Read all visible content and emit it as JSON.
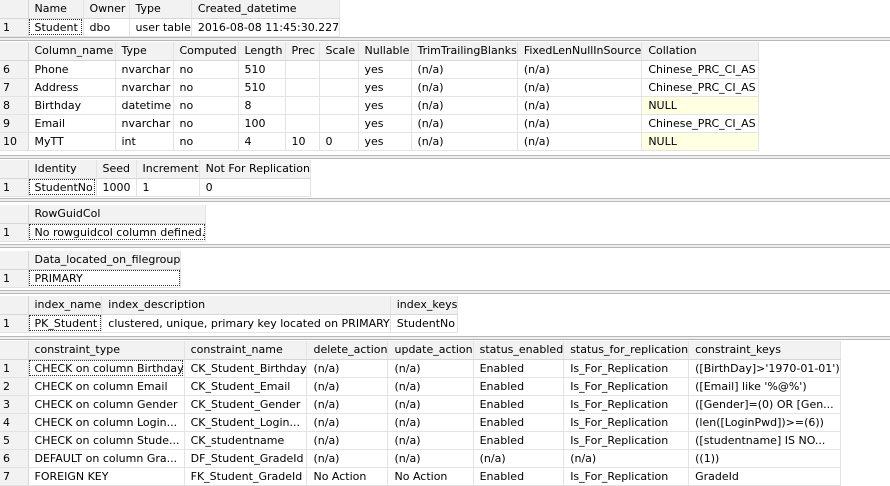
{
  "table_info": {
    "headers": [
      "Name",
      "Owner",
      "Type",
      "Created_datetime"
    ],
    "rows": [
      [
        "1",
        "Student",
        "dbo",
        "user table",
        "2016-08-08 11:45:30.227"
      ]
    ]
  },
  "columns": {
    "headers": [
      "Column_name",
      "Type",
      "Computed",
      "Length",
      "Prec",
      "Scale",
      "Nullable",
      "TrimTrailingBlanks",
      "FixedLenNullInSource",
      "Collation"
    ],
    "rows": [
      [
        "6",
        "Phone",
        "nvarchar",
        "no",
        "510",
        "",
        "",
        "yes",
        "(n/a)",
        "(n/a)",
        "Chinese_PRC_CI_AS"
      ],
      [
        "7",
        "Address",
        "nvarchar",
        "no",
        "510",
        "",
        "",
        "yes",
        "(n/a)",
        "(n/a)",
        "Chinese_PRC_CI_AS"
      ],
      [
        "8",
        "Birthday",
        "datetime",
        "no",
        "8",
        "",
        "",
        "yes",
        "(n/a)",
        "(n/a)",
        "NULL"
      ],
      [
        "9",
        "Email",
        "nvarchar",
        "no",
        "100",
        "",
        "",
        "yes",
        "(n/a)",
        "(n/a)",
        "Chinese_PRC_CI_AS"
      ],
      [
        "10",
        "MyTT",
        "int",
        "no",
        "4",
        "10",
        "0",
        "yes",
        "(n/a)",
        "(n/a)",
        "NULL"
      ]
    ]
  },
  "identity": {
    "headers": [
      "Identity",
      "Seed",
      "Increment",
      "Not For Replication"
    ],
    "rows": [
      [
        "1",
        "StudentNo",
        "1000",
        "1",
        "0"
      ]
    ]
  },
  "rowguid": {
    "headers": [
      "RowGuidCol"
    ],
    "rows": [
      [
        "1",
        "No rowguidcol column defined."
      ]
    ]
  },
  "filegroup": {
    "headers": [
      "Data_located_on_filegroup"
    ],
    "rows": [
      [
        "1",
        "PRIMARY"
      ]
    ]
  },
  "indexes": {
    "headers": [
      "index_name",
      "index_description",
      "index_keys"
    ],
    "rows": [
      [
        "1",
        "PK_Student",
        "clustered, unique, primary key located on PRIMARY",
        "StudentNo"
      ]
    ]
  },
  "constraints": {
    "headers": [
      "constraint_type",
      "constraint_name",
      "delete_action",
      "update_action",
      "status_enabled",
      "status_for_replication",
      "constraint_keys"
    ],
    "rows": [
      [
        "1",
        "CHECK on column Birthday",
        "CK_Student_Birthday",
        "(n/a)",
        "(n/a)",
        "Enabled",
        "Is_For_Replication",
        "([BirthDay]>'1970-01-01')"
      ],
      [
        "2",
        "CHECK on column Email",
        "CK_Student_Email",
        "(n/a)",
        "(n/a)",
        "Enabled",
        "Is_For_Replication",
        "([Email] like '%@%')"
      ],
      [
        "3",
        "CHECK on column Gender",
        "CK_Student_Gender",
        "(n/a)",
        "(n/a)",
        "Enabled",
        "Is_For_Replication",
        "([Gender]=(0) OR [Gen..."
      ],
      [
        "4",
        "CHECK on column Login...",
        "CK_Student_Login...",
        "(n/a)",
        "(n/a)",
        "Enabled",
        "Is_For_Replication",
        "(len([LoginPwd])>=(6))"
      ],
      [
        "5",
        "CHECK on column Stude...",
        "CK_studentname",
        "(n/a)",
        "(n/a)",
        "Enabled",
        "Is_For_Replication",
        "([studentname] IS NO..."
      ],
      [
        "6",
        "DEFAULT on column Gra...",
        "DF_Student_GradeId",
        "(n/a)",
        "(n/a)",
        "(n/a)",
        "(n/a)",
        "((1))"
      ],
      [
        "7",
        "FOREIGN KEY",
        "FK_Student_GradeId",
        "No Action",
        "No Action",
        "Enabled",
        "Is_For_Replication",
        "GradeId"
      ]
    ]
  }
}
